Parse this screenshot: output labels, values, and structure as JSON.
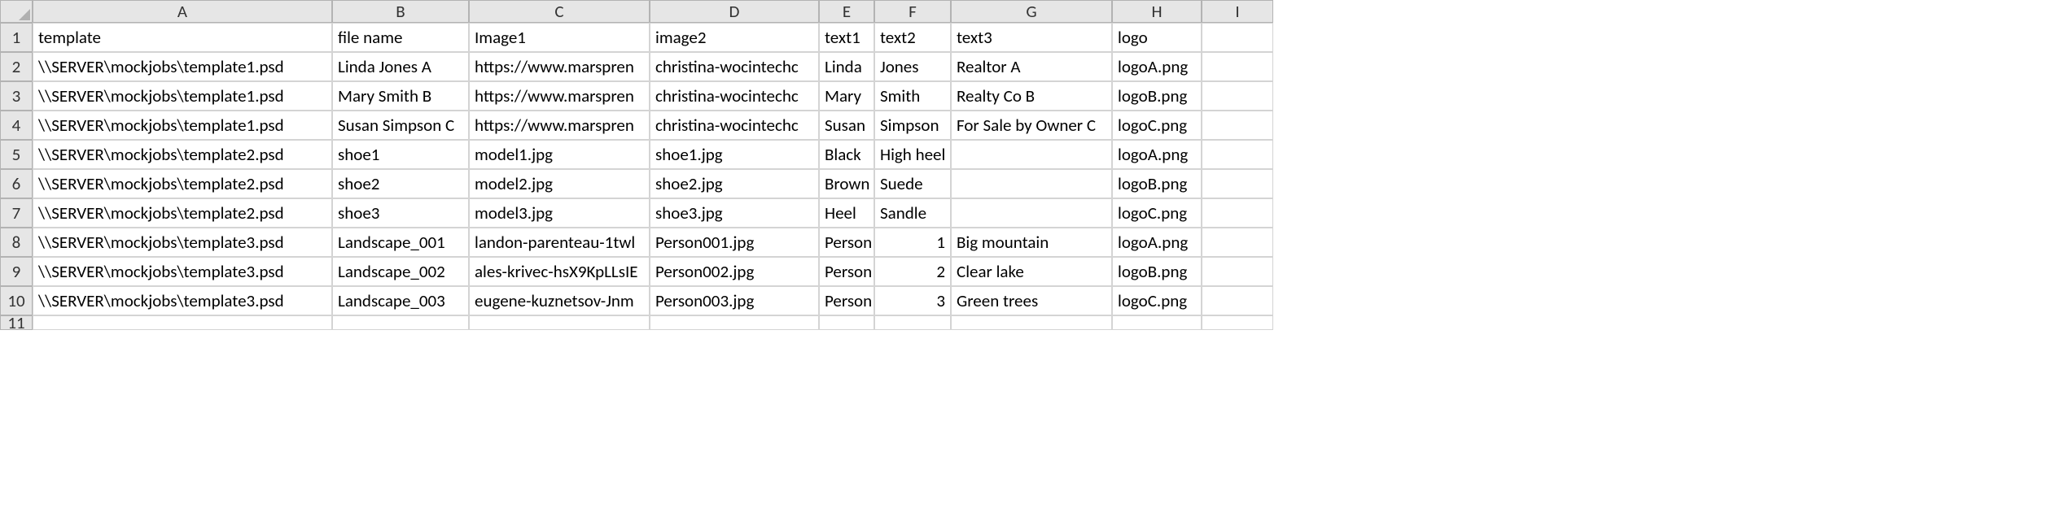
{
  "columns": [
    "A",
    "B",
    "C",
    "D",
    "E",
    "F",
    "G",
    "H",
    "I"
  ],
  "rowNums": [
    "1",
    "2",
    "3",
    "4",
    "5",
    "6",
    "7",
    "8",
    "9",
    "10",
    "11"
  ],
  "headers": [
    "template",
    "file name",
    "Image1",
    "image2",
    "text1",
    "text2",
    "text3",
    "logo",
    ""
  ],
  "rows": [
    [
      "\\\\SERVER\\mockjobs\\template1.psd",
      "Linda Jones A",
      "https://www.marspren",
      "christina-wocintechc",
      "Linda",
      "Jones",
      "Realtor A",
      "logoA.png",
      ""
    ],
    [
      "\\\\SERVER\\mockjobs\\template1.psd",
      "Mary Smith B",
      "https://www.marspren",
      "christina-wocintechc",
      "Mary",
      "Smith",
      "Realty Co B",
      "logoB.png",
      ""
    ],
    [
      "\\\\SERVER\\mockjobs\\template1.psd",
      "Susan Simpson C",
      "https://www.marspren",
      "christina-wocintechc",
      "Susan",
      "Simpson",
      "For Sale by Owner C",
      "logoC.png",
      ""
    ],
    [
      "\\\\SERVER\\mockjobs\\template2.psd",
      "shoe1",
      "model1.jpg",
      "shoe1.jpg",
      "Black",
      "High heel",
      "",
      "logoA.png",
      ""
    ],
    [
      "\\\\SERVER\\mockjobs\\template2.psd",
      "shoe2",
      "model2.jpg",
      "shoe2.jpg",
      "Brown",
      "Suede",
      "",
      "logoB.png",
      ""
    ],
    [
      "\\\\SERVER\\mockjobs\\template2.psd",
      "shoe3",
      "model3.jpg",
      "shoe3.jpg",
      "Heel",
      "Sandle",
      "",
      "logoC.png",
      ""
    ],
    [
      "\\\\SERVER\\mockjobs\\template3.psd",
      "Landscape_001",
      "landon-parenteau-1twl",
      "Person001.jpg",
      "Person",
      "1",
      "Big mountain",
      "logoA.png",
      ""
    ],
    [
      "\\\\SERVER\\mockjobs\\template3.psd",
      "Landscape_002",
      "ales-krivec-hsX9KpLLsIE",
      "Person002.jpg",
      "Person",
      "2",
      "Clear lake",
      "logoB.png",
      ""
    ],
    [
      "\\\\SERVER\\mockjobs\\template3.psd",
      "Landscape_003",
      "eugene-kuznetsov-Jnm",
      "Person003.jpg",
      "Person",
      "3",
      "Green trees",
      "logoC.png",
      ""
    ],
    [
      "",
      "",
      "",
      "",
      "",
      "",
      "",
      "",
      ""
    ]
  ],
  "numericCells": [
    {
      "r": 6,
      "c": 5
    },
    {
      "r": 7,
      "c": 5
    },
    {
      "r": 8,
      "c": 5
    }
  ]
}
